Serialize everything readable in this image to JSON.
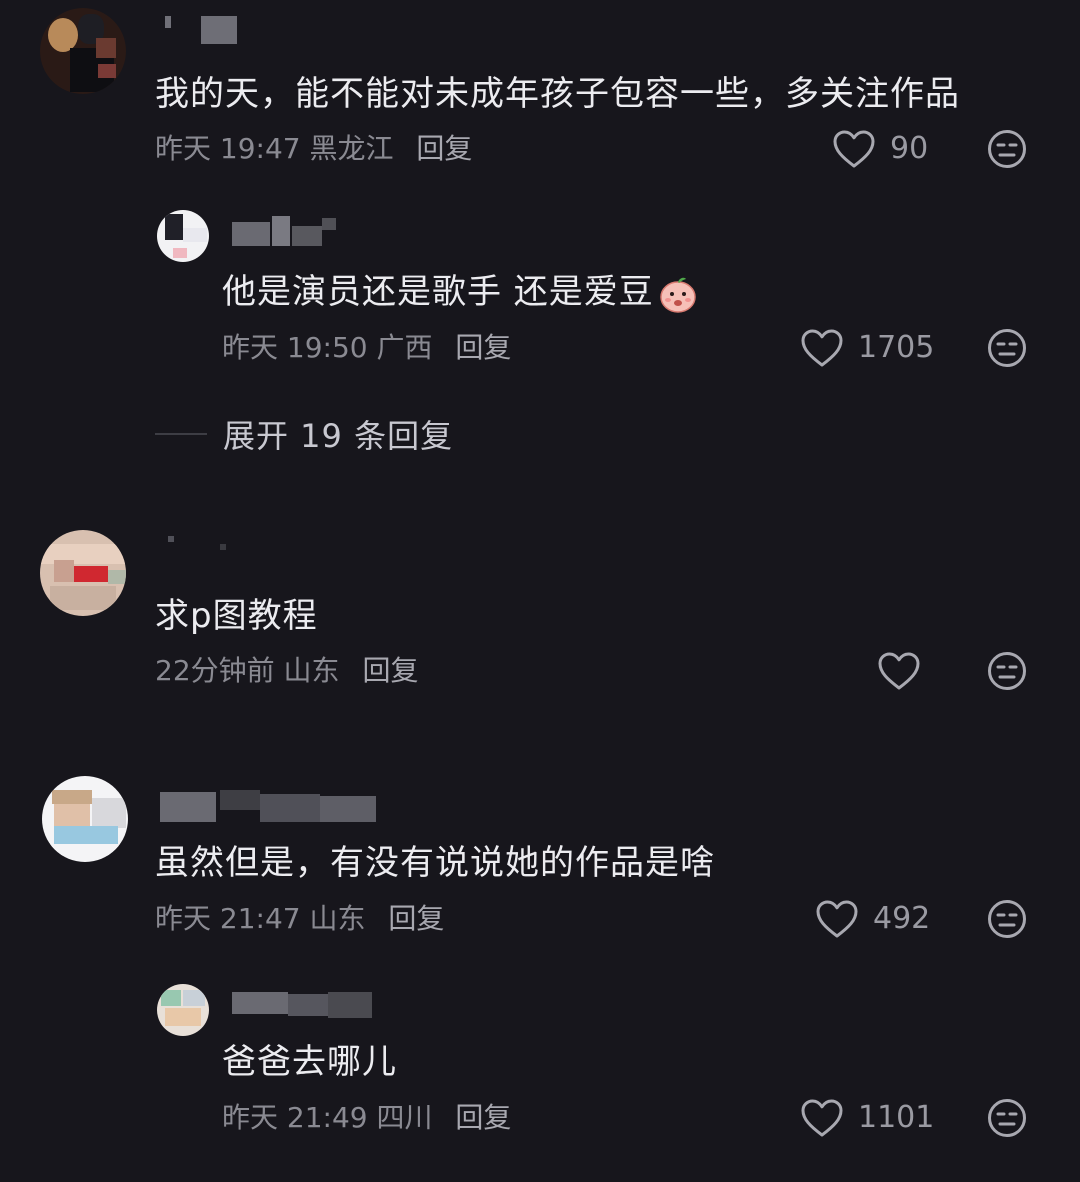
{
  "comments": [
    {
      "text": "我的天，能不能对未成年孩子包容一些，多关注作品",
      "time": "昨天 19:47",
      "location": "黑龙江",
      "reply_label": "回复",
      "likes": "90"
    },
    {
      "text": "他是演员还是歌手 还是爱豆",
      "time": "昨天 19:50",
      "location": "广西",
      "reply_label": "回复",
      "likes": "1705"
    },
    {
      "text": "求p图教程",
      "time": "22分钟前",
      "location": "山东",
      "reply_label": "回复",
      "likes": ""
    },
    {
      "text": "虽然但是，有没有说说她的作品是啥",
      "time": "昨天 21:47",
      "location": "山东",
      "reply_label": "回复",
      "likes": "492"
    },
    {
      "text": "爸爸去哪儿",
      "time": "昨天 21:49",
      "location": "四川",
      "reply_label": "回复",
      "likes": "1101"
    }
  ],
  "expand_replies": "展开 19 条回复",
  "icons": {
    "like": "heart-outline-icon",
    "dislike": "meh-face-icon",
    "emoji": "peach-emoji-icon"
  },
  "colors": {
    "background": "#17161c",
    "text": "#ececf0",
    "meta": "#8a8a92"
  }
}
